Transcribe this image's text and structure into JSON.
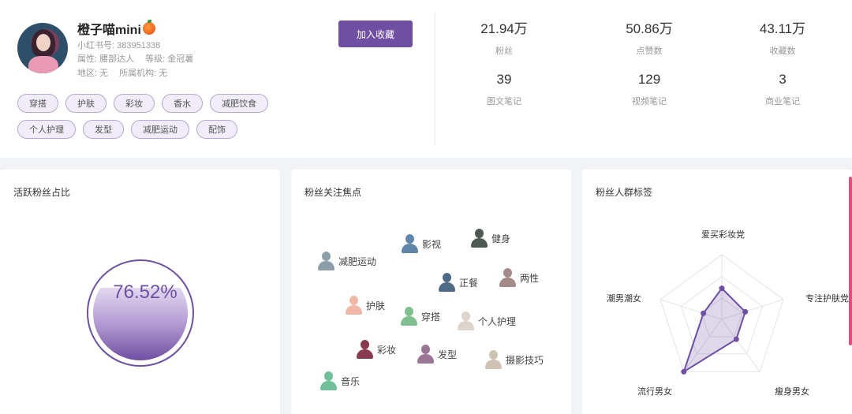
{
  "profile": {
    "name": "橙子喵mini",
    "id_line": "小红书号:  383951338",
    "attr_line": "属性:  腰部达人",
    "level_line": "等级:  金冠薯",
    "region_line": "地区:  无",
    "org_line": "所属机构:  无",
    "fav_button": "加入收藏",
    "tags": [
      "穿搭",
      "护肤",
      "彩妆",
      "香水",
      "减肥饮食",
      "个人护理",
      "发型",
      "减肥运动",
      "配饰"
    ]
  },
  "stats": [
    {
      "value": "21.94万",
      "label": "粉丝"
    },
    {
      "value": "50.86万",
      "label": "点赞数"
    },
    {
      "value": "43.11万",
      "label": "收藏数"
    },
    {
      "value": "39",
      "label": "图文笔记"
    },
    {
      "value": "129",
      "label": "视频笔记"
    },
    {
      "value": "3",
      "label": "商业笔记"
    }
  ],
  "active_fans": {
    "title": "活跃粉丝占比",
    "percent_text": "76.52%",
    "percent": 76.52
  },
  "focus": {
    "title": "粉丝关注焦点",
    "items": [
      {
        "label": "影视",
        "color": "#5f86a8"
      },
      {
        "label": "健身",
        "color": "#4d5a52"
      },
      {
        "label": "减肥运动",
        "color": "#8d9eab"
      },
      {
        "label": "正餐",
        "color": "#4e6a86"
      },
      {
        "label": "两性",
        "color": "#a58a8a"
      },
      {
        "label": "护肤",
        "color": "#efb8a6"
      },
      {
        "label": "穿搭",
        "color": "#7fbf8f"
      },
      {
        "label": "个人护理",
        "color": "#ddd4cc"
      },
      {
        "label": "彩妆",
        "color": "#8a3a4e"
      },
      {
        "label": "发型",
        "color": "#9b7596"
      },
      {
        "label": "摄影技巧",
        "color": "#cec3b3"
      },
      {
        "label": "音乐",
        "color": "#6fbf9a"
      }
    ]
  },
  "crowd": {
    "title": "粉丝人群标签",
    "axes": [
      "爱买彩妆党",
      "专注护肤党",
      "瘦身男女",
      "流行男女",
      "潮男潮女"
    ],
    "values": [
      0.48,
      0.38,
      0.38,
      1.0,
      0.3
    ],
    "accent": "#6f4fa2"
  }
}
